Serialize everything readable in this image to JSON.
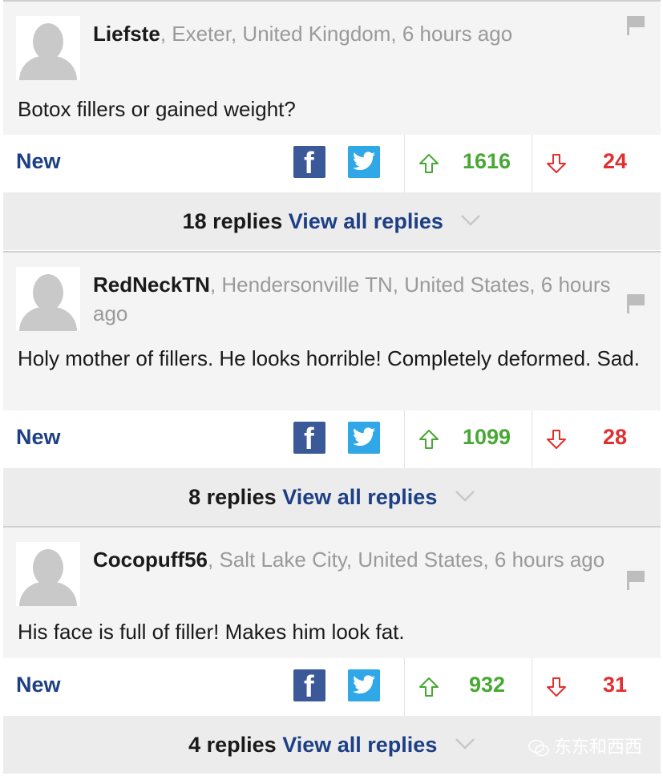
{
  "comments": [
    {
      "username": "Liefste",
      "meta": ", Exeter, United Kingdom, 6 hours ago",
      "text": "Botox fillers or gained weight?",
      "new_label": "New",
      "upvotes": "1616",
      "downvotes": "24",
      "replies_count": "18 replies",
      "view_all": "View all replies"
    },
    {
      "username": "RedNeckTN",
      "meta": ", Hendersonville TN, United States, 6 hours ago",
      "text": "Holy mother of fillers. He looks horrible! Completely deformed. Sad.",
      "new_label": "New",
      "upvotes": "1099",
      "downvotes": "28",
      "replies_count": "8 replies",
      "view_all": "View all replies"
    },
    {
      "username": "Cocopuff56",
      "meta": ", Salt Lake City, United States, 6 hours ago",
      "text": "His face is full of filler! Makes him look fat.",
      "new_label": "New",
      "upvotes": "932",
      "downvotes": "31",
      "replies_count": "4 replies",
      "view_all": "View all replies"
    }
  ],
  "icons": {
    "facebook": "f",
    "twitter": "twitter-bird-icon",
    "upvote": "arrow-up-outline-icon",
    "downvote": "arrow-down-outline-icon",
    "flag": "flag-icon",
    "chevron": "chevron-down-icon"
  },
  "colors": {
    "link_blue": "#1d3f85",
    "upvote_green": "#48a834",
    "downvote_red": "#e22f2f",
    "facebook_blue": "#3b5998",
    "twitter_blue": "#30a7e6"
  },
  "watermark": "东东和西西"
}
